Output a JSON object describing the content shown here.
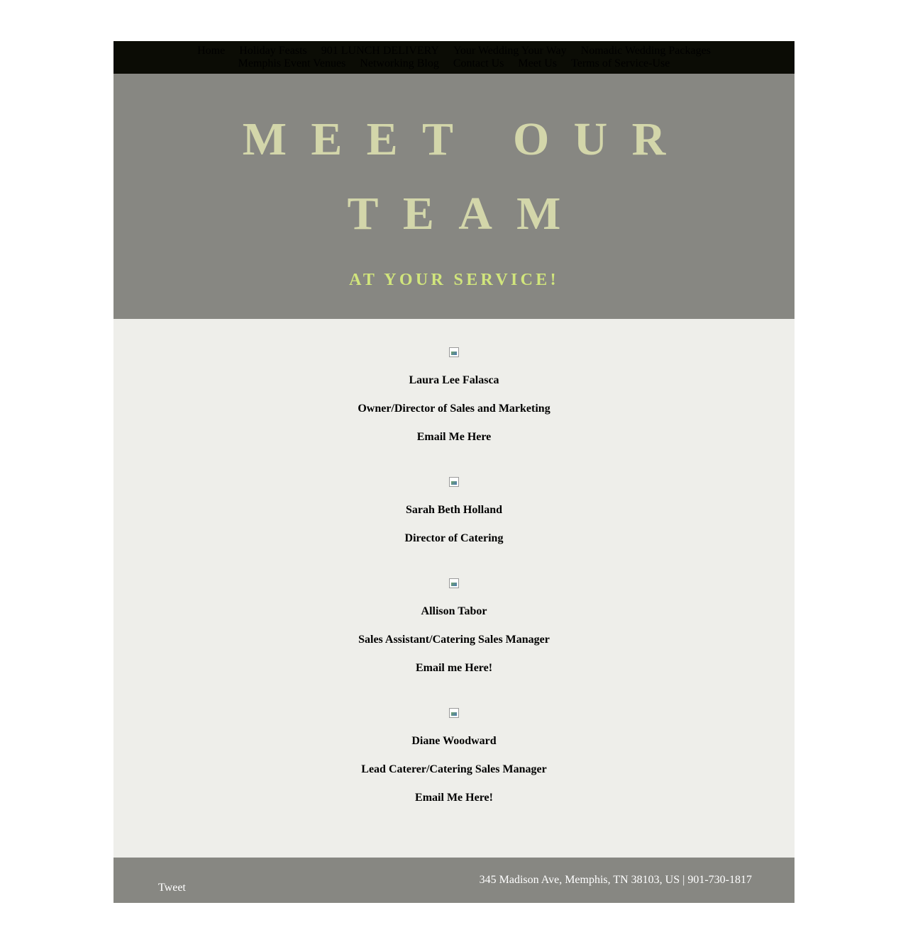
{
  "nav": {
    "items": [
      "Home",
      "Holiday Feasts",
      "901 LUNCH DELIVERY",
      "Your Wedding Your Way",
      "Nomadic Wedding Packages",
      "Memphis Event Venues",
      "Networking Blog",
      "Contact Us",
      "Meet Us",
      "Terms of Service-Use"
    ]
  },
  "hero": {
    "title_line1": "MEET OUR",
    "title_line2": "TEAM",
    "subtitle": "AT YOUR SERVICE!"
  },
  "team": [
    {
      "name": "Laura Lee Falasca",
      "role": "Owner/Director of Sales and Marketing",
      "email_link": "Email Me Here"
    },
    {
      "name": "Sarah Beth Holland",
      "role": "Director of Catering",
      "email_link": ""
    },
    {
      "name": "Allison Tabor",
      "role": "Sales Assistant/Catering Sales Manager",
      "email_link": "Email me Here!"
    },
    {
      "name": "Diane Woodward",
      "role": "Lead Caterer/Catering Sales Manager",
      "email_link": "Email Me Here!"
    }
  ],
  "footer": {
    "tweet": "Tweet",
    "address": "345 Madison Ave, Memphis, TN 38103, US | 901-730-1817"
  },
  "colors": {
    "nav_bg": "#0b0c05",
    "hero_bg": "#878782",
    "title": "#d3d6aa",
    "subtitle": "#d1e57c",
    "content_bg": "#eeeeea"
  }
}
